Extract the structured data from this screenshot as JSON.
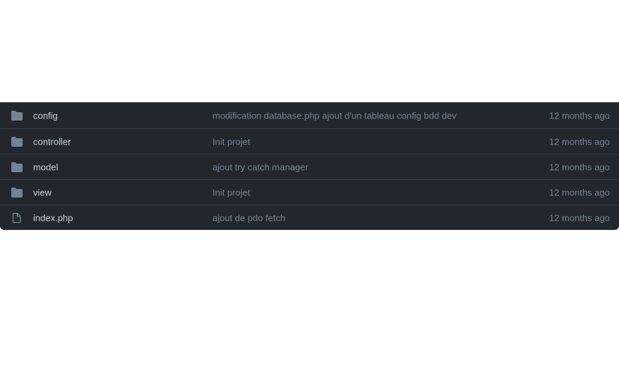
{
  "files": [
    {
      "name": "config",
      "type": "folder",
      "icon": "folder-icon",
      "message": "modification database.php ajout d'un tableau config bdd dev",
      "age": "12 months ago"
    },
    {
      "name": "controller",
      "type": "folder",
      "icon": "folder-icon",
      "message": "Init projet",
      "age": "12 months ago"
    },
    {
      "name": "model",
      "type": "folder",
      "icon": "folder-icon",
      "message": "ajout try catch manager",
      "age": "12 months ago"
    },
    {
      "name": "view",
      "type": "folder",
      "icon": "folder-icon",
      "message": "Init projet",
      "age": "12 months ago"
    },
    {
      "name": "index.php",
      "type": "file",
      "icon": "file-icon",
      "message": "ajout de pdo fetch",
      "age": "12 months ago"
    }
  ],
  "colors": {
    "background": "#22272e",
    "divider": "#373e47",
    "name_text": "#c7d0d9",
    "muted_text": "#768390",
    "folder_icon": "#768390",
    "file_icon": "#768390"
  }
}
